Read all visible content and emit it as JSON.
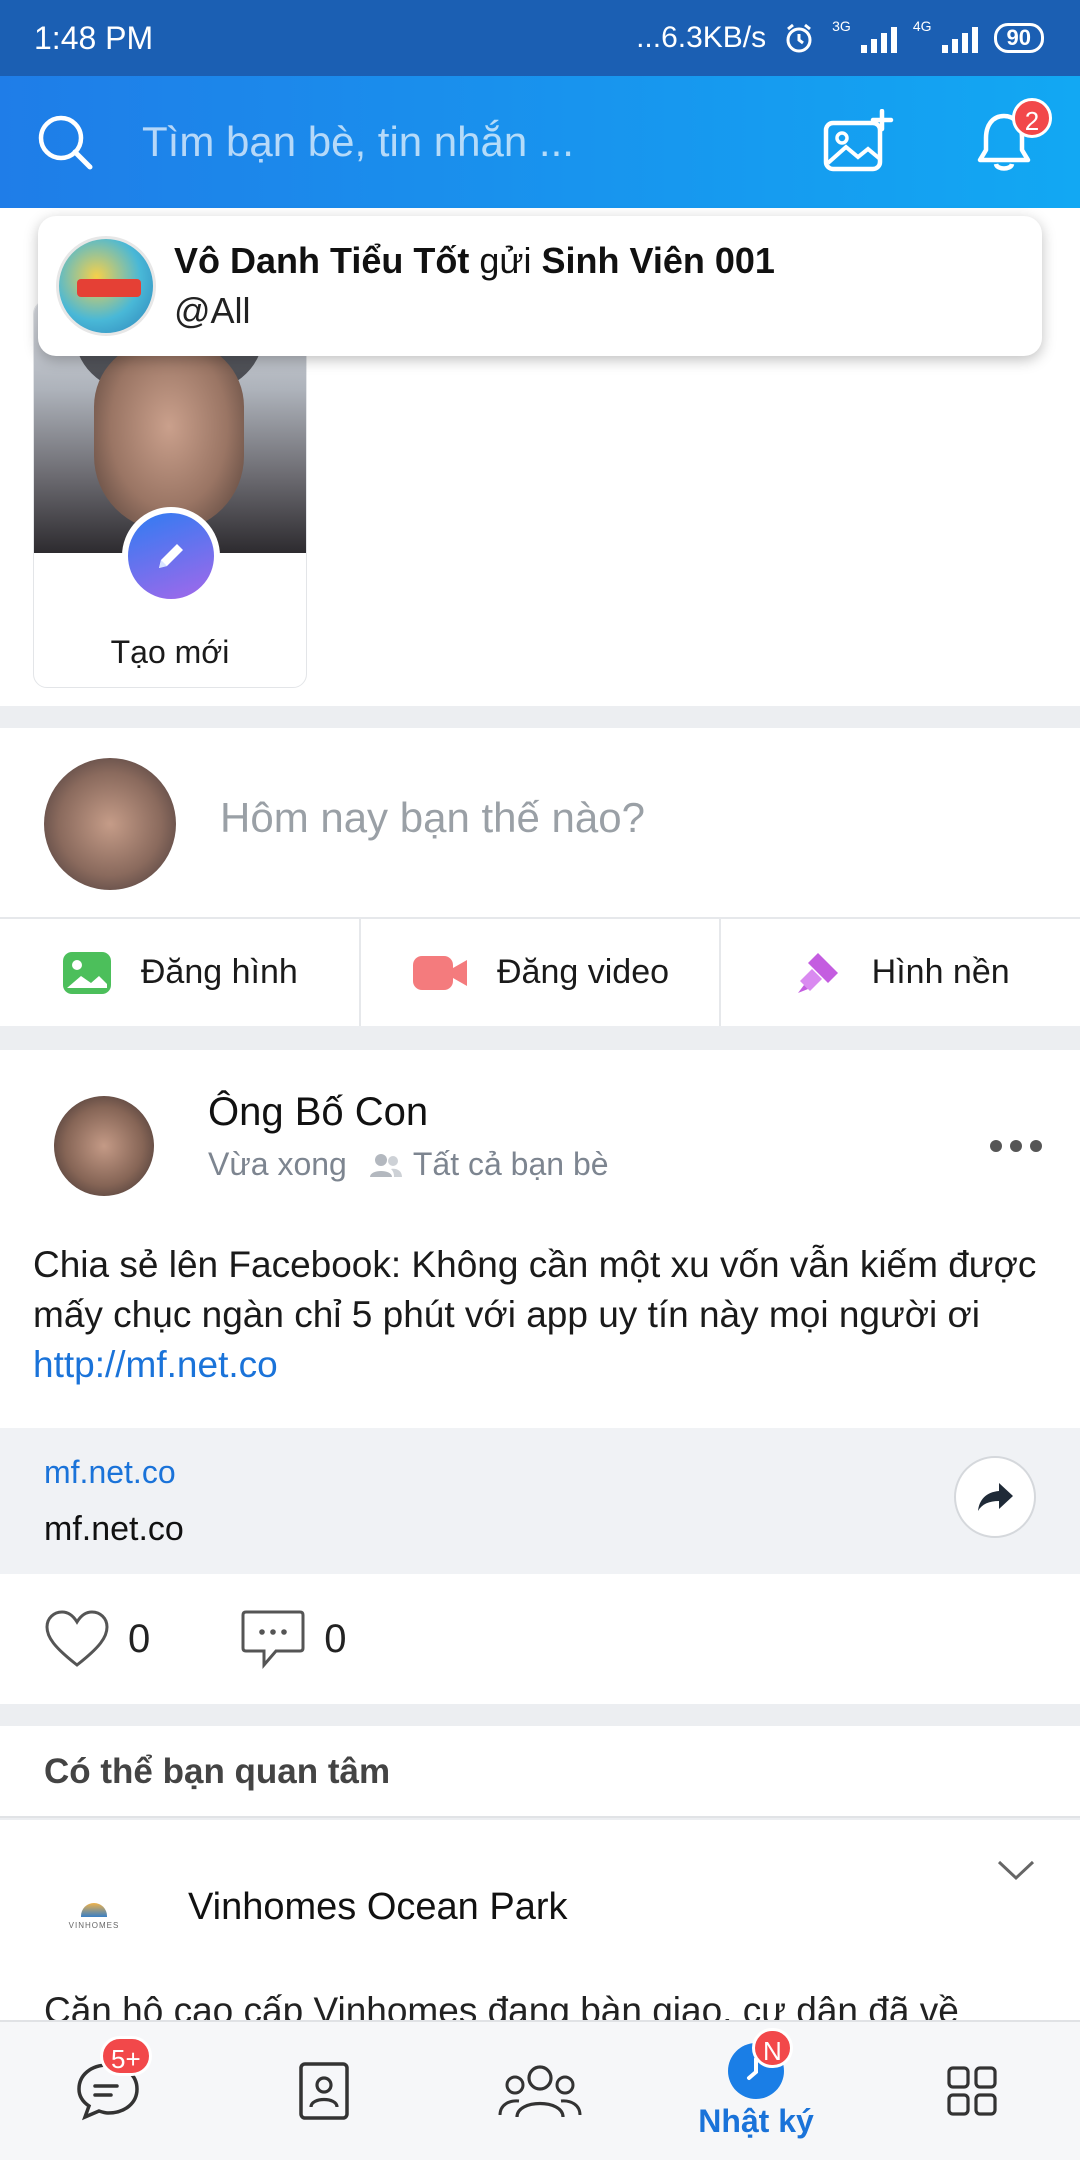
{
  "status_bar": {
    "time": "1:48 PM",
    "net_speed": "...6.3KB/s",
    "net1": "3G",
    "net2": "4G",
    "battery": "90"
  },
  "header": {
    "search_placeholder": "Tìm bạn bè, tin nhắn ...",
    "notification_count": "2",
    "colors": {
      "gradient_start": "#1f7de8",
      "gradient_end": "#12a8f3"
    }
  },
  "toast": {
    "sender": "Vô Danh Tiểu Tốt",
    "verb": "gửi",
    "group": "Sinh Viên 001",
    "message": "@All"
  },
  "story": {
    "create_label": "Tạo mới"
  },
  "composer": {
    "placeholder": "Hôm nay bạn thế nào?",
    "actions": [
      {
        "label": "Đăng hình",
        "icon": "image-icon",
        "color": "#4cbf5b"
      },
      {
        "label": "Đăng video",
        "icon": "video-camera-icon",
        "color": "#f47b7d"
      },
      {
        "label": "Hình nền",
        "icon": "paint-brush-icon",
        "color": "#c45de0"
      }
    ]
  },
  "post": {
    "author": "Ông Bố  Con",
    "time": "Vừa xong",
    "audience": "Tất cả bạn bè",
    "text": "Chia sẻ lên Facebook: Không cần một xu vốn vẫn kiếm được mấy chục ngàn chỉ 5 phút với app uy tín này mọi người ơi ",
    "link": "http://mf.net.co",
    "preview_domain": "mf.net.co",
    "preview_title": "mf.net.co",
    "likes": "0",
    "comments": "0"
  },
  "suggestions": {
    "heading": "Có thể bạn quan tâm",
    "item": {
      "name": "Vinhomes Ocean Park",
      "logo_text": "VINHOMES",
      "snippet": "Căn hộ cao cấp Vinhomes đang bàn giao, cư dân đã về"
    }
  },
  "bottom_nav": {
    "messages_badge": "5+",
    "timeline_badge": "N",
    "active_label": "Nhật ký",
    "accent": "#1a73d9"
  }
}
